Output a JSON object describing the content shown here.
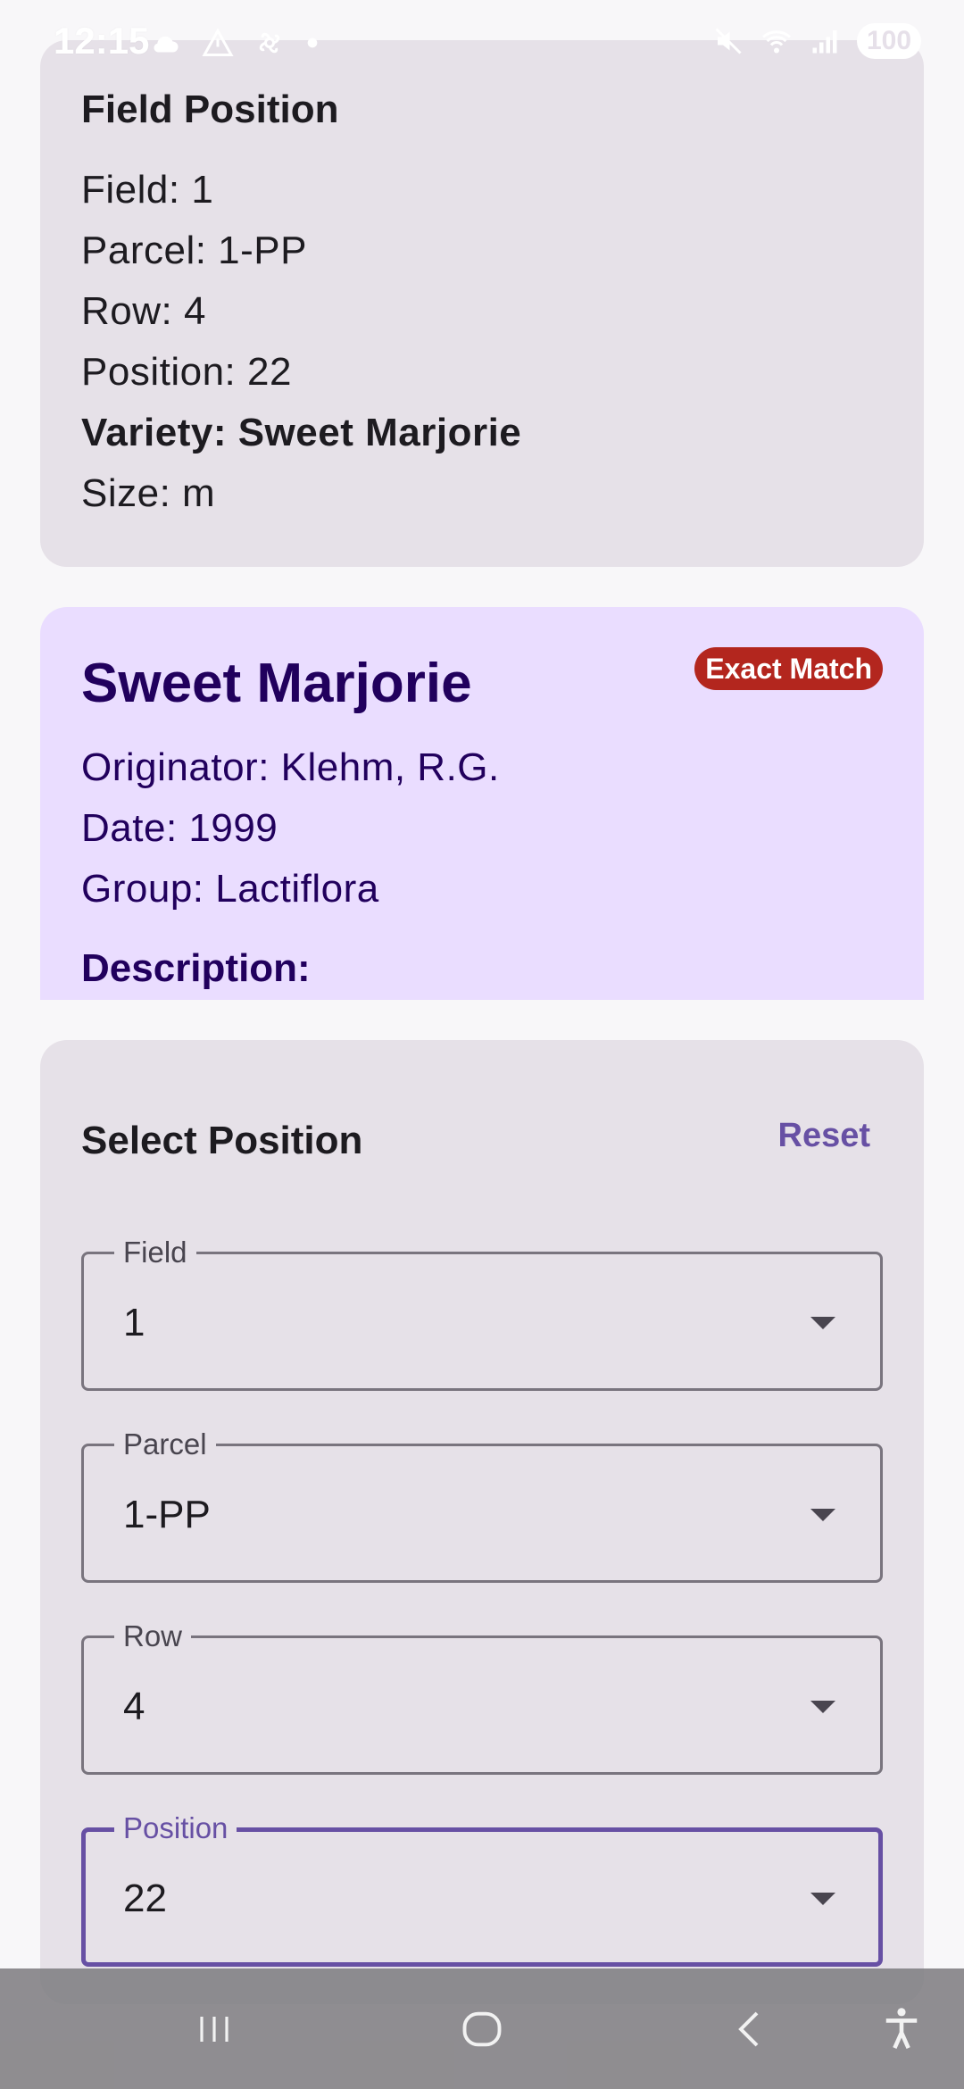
{
  "status_bar": {
    "time": "12:15",
    "battery": "100",
    "icons_left": [
      "cloud-icon",
      "alert-icon",
      "fan-icon",
      "dot-icon"
    ],
    "icons_right": [
      "mute-icon",
      "wifi-icon",
      "signal-icon",
      "battery-icon"
    ]
  },
  "field_position": {
    "title": "Field Position",
    "field": "Field: 1",
    "parcel": "Parcel: 1-PP",
    "row": "Row: 4",
    "position": "Position: 22",
    "variety": "Variety: Sweet Marjorie",
    "size": "Size: m"
  },
  "variety_card": {
    "name": "Sweet Marjorie",
    "badge": "Exact Match",
    "originator": "Originator: Klehm, R.G.",
    "date": "Date: 1999",
    "group": "Group: Lactiflora",
    "description_label": "Description:"
  },
  "select_position": {
    "title": "Select Position",
    "reset_label": "Reset",
    "dropdowns": [
      {
        "label": "Field",
        "value": "1"
      },
      {
        "label": "Parcel",
        "value": "1-PP"
      },
      {
        "label": "Row",
        "value": "4"
      },
      {
        "label": "Position",
        "value": "22"
      }
    ]
  },
  "nav": {
    "icons": [
      "recent-apps-icon",
      "home-icon",
      "back-icon",
      "accessibility-icon"
    ]
  },
  "colors": {
    "primary": "#6750a4",
    "variety_bg": "#eaddff",
    "card_bg": "#e6e1e8",
    "badge": "#b3261e"
  }
}
